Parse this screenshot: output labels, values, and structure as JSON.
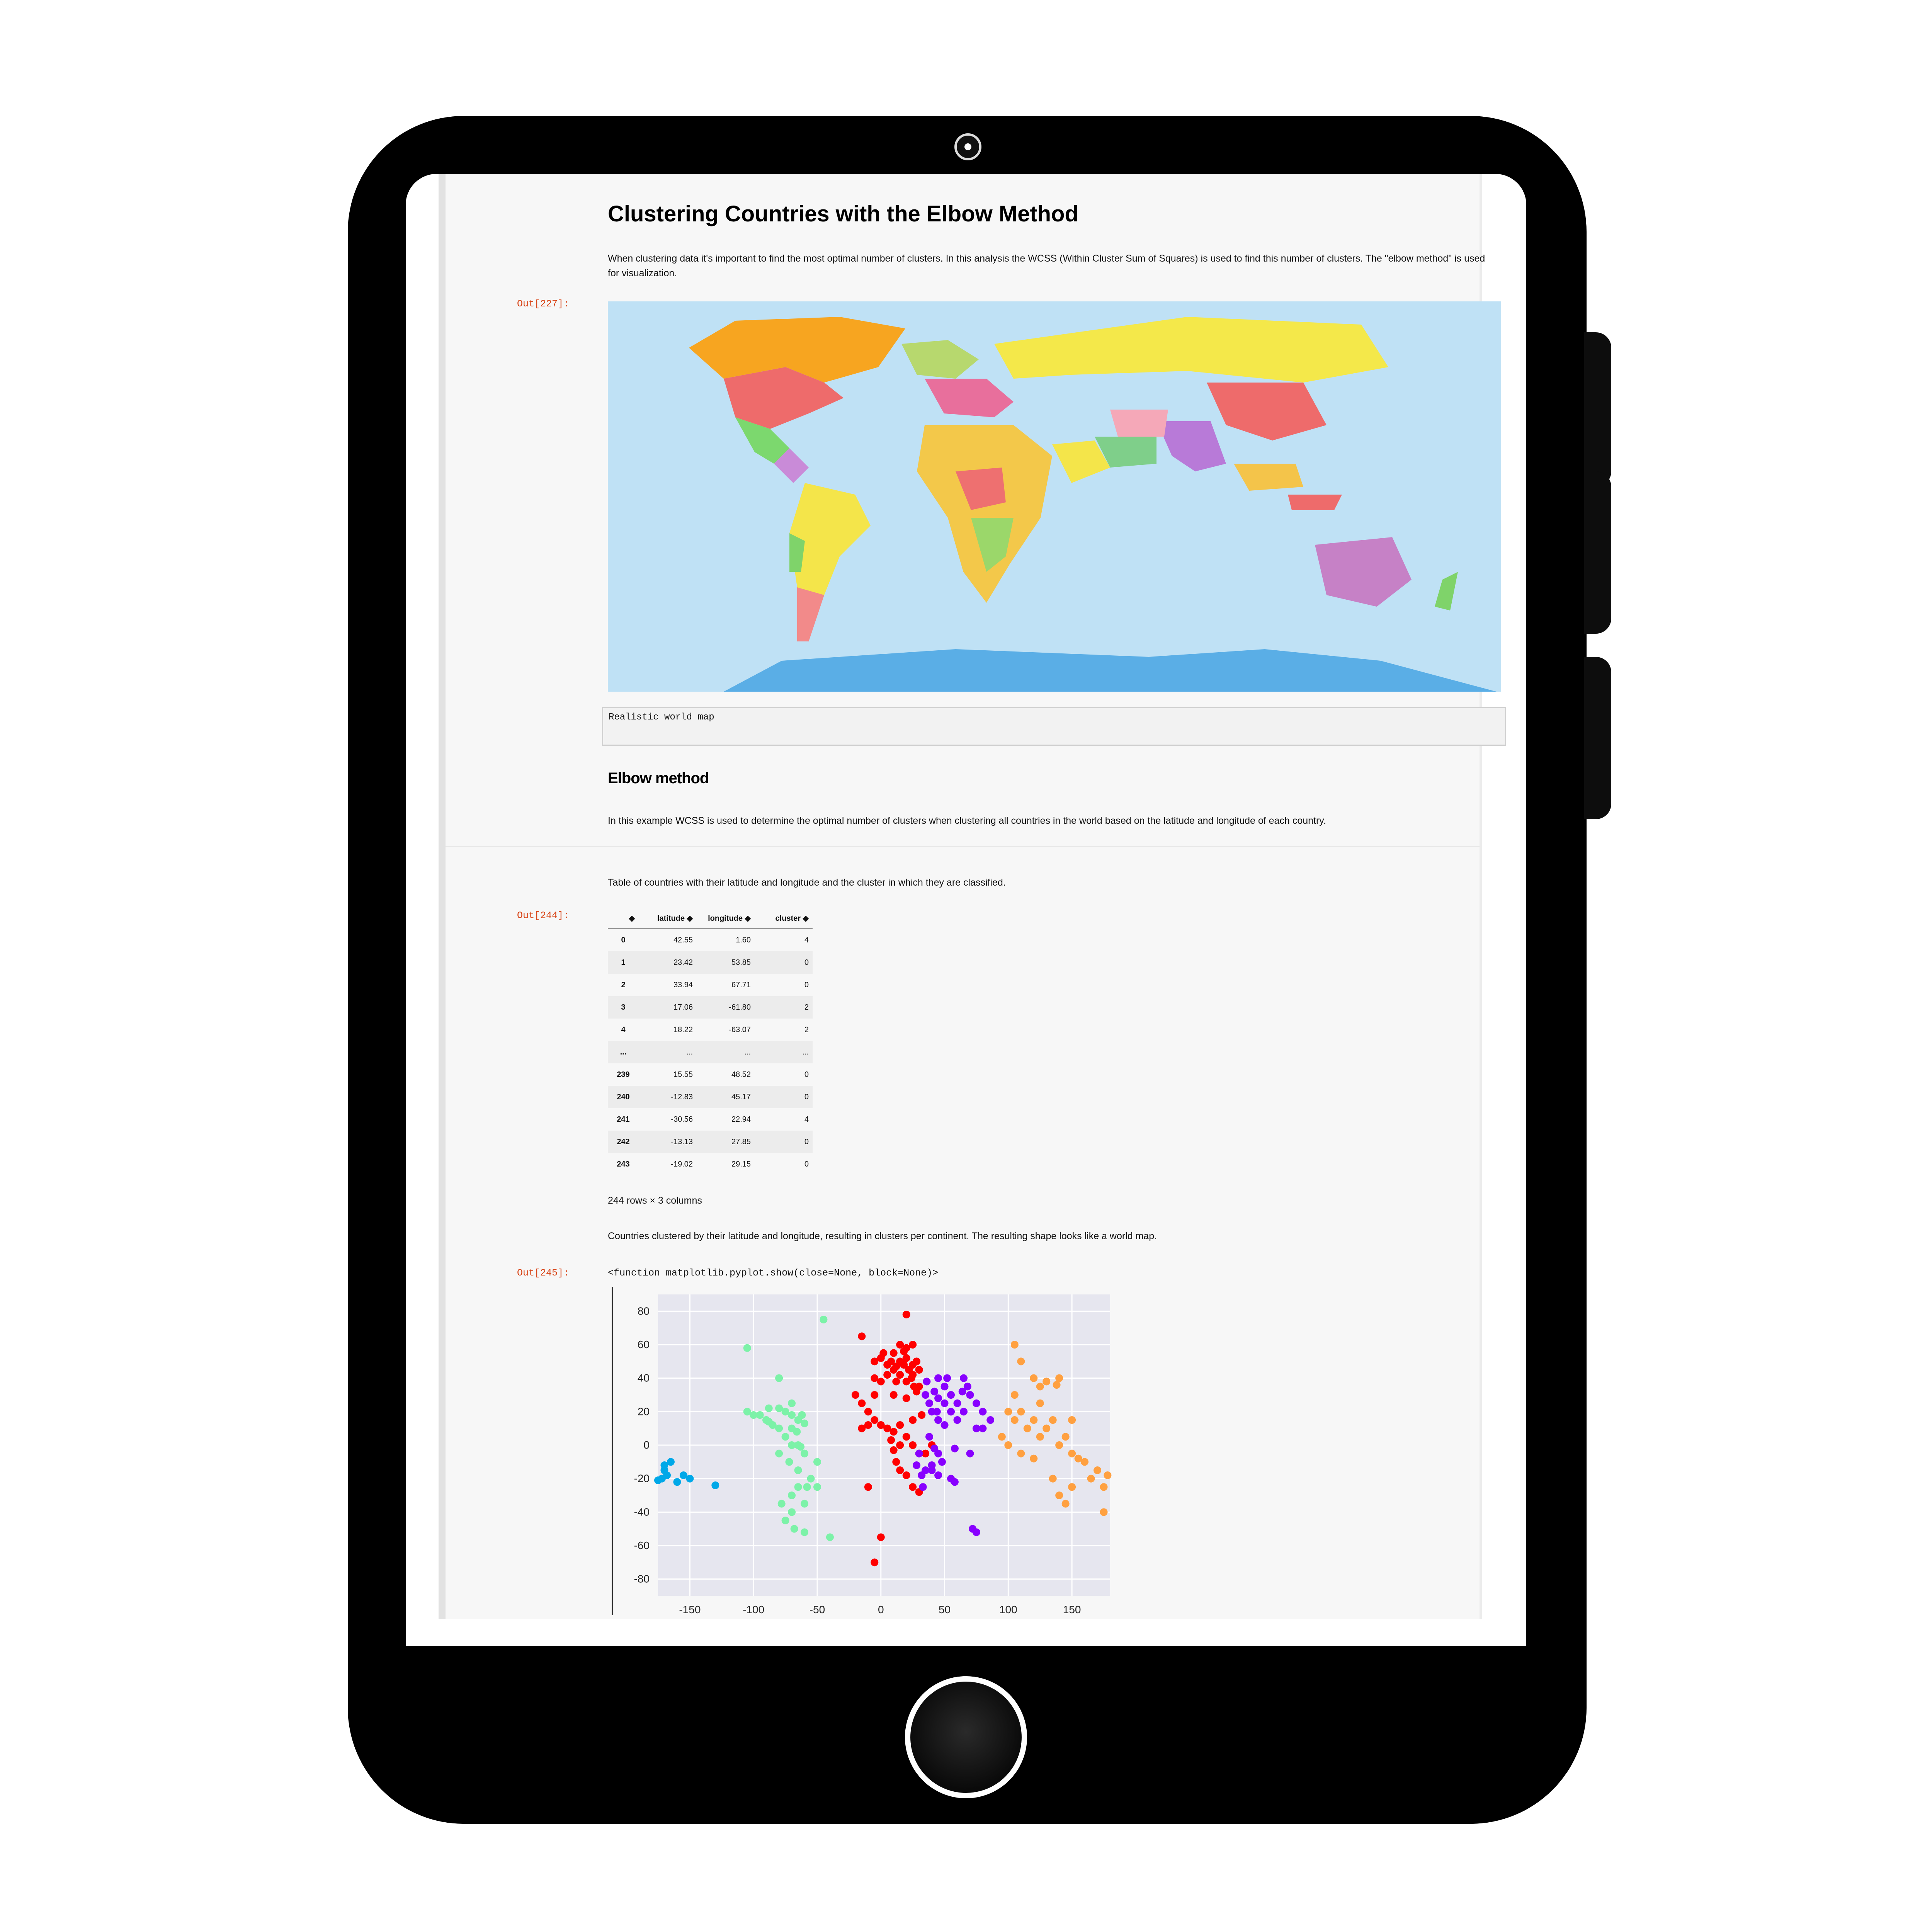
{
  "notebook": {
    "title": "Clustering Countries with the Elbow Method",
    "intro": "When clustering data it's important to find the most optimal number of clusters. In this analysis the WCSS (Within Cluster Sum of Squares) is used to find this number of clusters. The \"elbow method\" is used for visualization.",
    "prompt_map": "Out[227]:",
    "map_caption": "Realistic world map",
    "section_title": "Elbow method",
    "section_text": "In this example WCSS is used to determine the optimal number of clusters when clustering all countries in the world based on the latitude and longitude of each country.",
    "table_intro": "Table of countries with their latitude and longitude and the cluster in which they are classified.",
    "prompt_table": "Out[244]:",
    "table_columns": [
      "latitude",
      "longitude",
      "cluster"
    ],
    "table_rows": [
      [
        "0",
        "42.55",
        "1.60",
        "4"
      ],
      [
        "1",
        "23.42",
        "53.85",
        "0"
      ],
      [
        "2",
        "33.94",
        "67.71",
        "0"
      ],
      [
        "3",
        "17.06",
        "-61.80",
        "2"
      ],
      [
        "4",
        "18.22",
        "-63.07",
        "2"
      ],
      [
        "...",
        "...",
        "...",
        "..."
      ],
      [
        "239",
        "15.55",
        "48.52",
        "0"
      ],
      [
        "240",
        "-12.83",
        "45.17",
        "0"
      ],
      [
        "241",
        "-30.56",
        "22.94",
        "4"
      ],
      [
        "242",
        "-13.13",
        "27.85",
        "0"
      ],
      [
        "243",
        "-19.02",
        "29.15",
        "0"
      ]
    ],
    "table_shape": "244 rows × 3 columns",
    "scatter_intro": "Countries clustered by their latitude and longitude, resulting in clusters per continent. The resulting shape looks like a world map.",
    "prompt_plot": "Out[245]:",
    "plot_output": "<function matplotlib.pyplot.show(close=None, block=None)>"
  },
  "chart_data": {
    "type": "scatter",
    "xlim": [
      -175,
      180
    ],
    "ylim": [
      -90,
      90
    ],
    "xticks": [
      -150,
      -100,
      -50,
      0,
      50,
      100,
      150
    ],
    "yticks": [
      80,
      60,
      40,
      20,
      0,
      -20,
      -40,
      -60,
      -80
    ],
    "grid": true,
    "series": [
      {
        "color": "#00a8e8",
        "points": [
          [
            -170,
            -15
          ],
          [
            -168,
            -18
          ],
          [
            -172,
            -20
          ],
          [
            -165,
            -10
          ],
          [
            -160,
            -22
          ],
          [
            -170,
            -12
          ],
          [
            -155,
            -18
          ],
          [
            -150,
            -20
          ],
          [
            -130,
            -24
          ],
          [
            -175,
            -21
          ]
        ]
      },
      {
        "color": "#7cf2a8",
        "points": [
          [
            -45,
            75
          ],
          [
            -105,
            58
          ],
          [
            -80,
            40
          ],
          [
            -105,
            20
          ],
          [
            -100,
            18
          ],
          [
            -90,
            15
          ],
          [
            -85,
            12
          ],
          [
            -80,
            10
          ],
          [
            -75,
            20
          ],
          [
            -70,
            18
          ],
          [
            -65,
            15
          ],
          [
            -60,
            13
          ],
          [
            -62,
            18
          ],
          [
            -70,
            25
          ],
          [
            -80,
            22
          ],
          [
            -88,
            14
          ],
          [
            -75,
            5
          ],
          [
            -70,
            0
          ],
          [
            -60,
            -5
          ],
          [
            -50,
            -10
          ],
          [
            -65,
            -15
          ],
          [
            -58,
            -25
          ],
          [
            -70,
            -30
          ],
          [
            -60,
            -35
          ],
          [
            -70,
            -40
          ],
          [
            -68,
            -50
          ],
          [
            -60,
            -52
          ],
          [
            -40,
            -55
          ],
          [
            -75,
            -45
          ],
          [
            -78,
            -35
          ],
          [
            -55,
            -20
          ],
          [
            -50,
            -25
          ],
          [
            -65,
            -25
          ],
          [
            -72,
            -10
          ],
          [
            -80,
            -5
          ],
          [
            -90,
            15
          ],
          [
            -95,
            18
          ],
          [
            -88,
            22
          ],
          [
            -65,
            0
          ],
          [
            -70,
            10
          ],
          [
            -63,
            -1
          ],
          [
            -66,
            8
          ]
        ]
      },
      {
        "color": "#ff0000",
        "points": [
          [
            20,
            78
          ],
          [
            -15,
            65
          ],
          [
            -5,
            50
          ],
          [
            0,
            52
          ],
          [
            5,
            48
          ],
          [
            8,
            50
          ],
          [
            10,
            45
          ],
          [
            12,
            47
          ],
          [
            15,
            50
          ],
          [
            18,
            48
          ],
          [
            20,
            52
          ],
          [
            22,
            45
          ],
          [
            25,
            48
          ],
          [
            28,
            50
          ],
          [
            10,
            55
          ],
          [
            15,
            60
          ],
          [
            20,
            58
          ],
          [
            25,
            60
          ],
          [
            5,
            42
          ],
          [
            15,
            42
          ],
          [
            20,
            38
          ],
          [
            25,
            42
          ],
          [
            -5,
            40
          ],
          [
            0,
            38
          ],
          [
            12,
            38
          ],
          [
            30,
            45
          ],
          [
            2,
            55
          ],
          [
            18,
            56
          ],
          [
            -20,
            30
          ],
          [
            -15,
            25
          ],
          [
            -10,
            20
          ],
          [
            -5,
            15
          ],
          [
            0,
            12
          ],
          [
            5,
            10
          ],
          [
            10,
            8
          ],
          [
            15,
            12
          ],
          [
            20,
            5
          ],
          [
            25,
            0
          ],
          [
            30,
            -5
          ],
          [
            10,
            -3
          ],
          [
            12,
            -10
          ],
          [
            15,
            -15
          ],
          [
            20,
            -18
          ],
          [
            25,
            -25
          ],
          [
            30,
            -28
          ],
          [
            35,
            -5
          ],
          [
            40,
            0
          ],
          [
            8,
            3
          ],
          [
            -10,
            12
          ],
          [
            -15,
            10
          ],
          [
            -5,
            30
          ],
          [
            10,
            30
          ],
          [
            20,
            28
          ],
          [
            -10,
            -25
          ],
          [
            0,
            -55
          ],
          [
            -5,
            -70
          ],
          [
            15,
            0
          ],
          [
            25,
            15
          ],
          [
            32,
            18
          ],
          [
            24,
            40
          ],
          [
            30,
            35
          ],
          [
            26,
            35
          ],
          [
            28,
            32
          ]
        ]
      },
      {
        "color": "#8800ff",
        "points": [
          [
            45,
            40
          ],
          [
            50,
            35
          ],
          [
            55,
            30
          ],
          [
            60,
            25
          ],
          [
            45,
            28
          ],
          [
            50,
            25
          ],
          [
            42,
            32
          ],
          [
            52,
            40
          ],
          [
            65,
            40
          ],
          [
            68,
            35
          ],
          [
            70,
            30
          ],
          [
            75,
            25
          ],
          [
            40,
            20
          ],
          [
            45,
            15
          ],
          [
            50,
            12
          ],
          [
            35,
            30
          ],
          [
            38,
            25
          ],
          [
            55,
            20
          ],
          [
            60,
            15
          ],
          [
            65,
            20
          ],
          [
            80,
            20
          ],
          [
            75,
            10
          ],
          [
            45,
            -18
          ],
          [
            40,
            -12
          ],
          [
            35,
            -15
          ],
          [
            55,
            -20
          ],
          [
            58,
            -22
          ],
          [
            70,
            -5
          ],
          [
            72,
            -50
          ],
          [
            75,
            -52
          ],
          [
            36,
            38
          ],
          [
            44,
            20
          ],
          [
            64,
            32
          ],
          [
            30,
            -5
          ],
          [
            28,
            -12
          ],
          [
            32,
            -18
          ],
          [
            48,
            -10
          ],
          [
            42,
            -2
          ],
          [
            80,
            10
          ],
          [
            86,
            15
          ],
          [
            38,
            5
          ],
          [
            33,
            -25
          ],
          [
            58,
            -2
          ],
          [
            40,
            -15
          ],
          [
            45,
            -5
          ]
        ]
      },
      {
        "color": "#ffa040",
        "points": [
          [
            105,
            60
          ],
          [
            110,
            50
          ],
          [
            120,
            40
          ],
          [
            125,
            35
          ],
          [
            130,
            38
          ],
          [
            138,
            36
          ],
          [
            140,
            40
          ],
          [
            100,
            20
          ],
          [
            105,
            15
          ],
          [
            110,
            20
          ],
          [
            115,
            10
          ],
          [
            120,
            15
          ],
          [
            125,
            5
          ],
          [
            130,
            10
          ],
          [
            135,
            15
          ],
          [
            140,
            0
          ],
          [
            145,
            5
          ],
          [
            150,
            -5
          ],
          [
            155,
            -8
          ],
          [
            160,
            -10
          ],
          [
            165,
            -20
          ],
          [
            170,
            -15
          ],
          [
            175,
            -25
          ],
          [
            178,
            -18
          ],
          [
            150,
            -25
          ],
          [
            140,
            -30
          ],
          [
            135,
            -20
          ],
          [
            145,
            -35
          ],
          [
            175,
            -40
          ],
          [
            100,
            0
          ],
          [
            95,
            5
          ],
          [
            110,
            -5
          ],
          [
            120,
            -8
          ],
          [
            125,
            25
          ],
          [
            105,
            30
          ],
          [
            150,
            15
          ]
        ]
      }
    ]
  },
  "colors": {
    "prompt": "#d84315",
    "tablet_frame": "#000000",
    "notebook_bg": "#f7f7f7",
    "plot_bg": "#e6e6ef"
  }
}
